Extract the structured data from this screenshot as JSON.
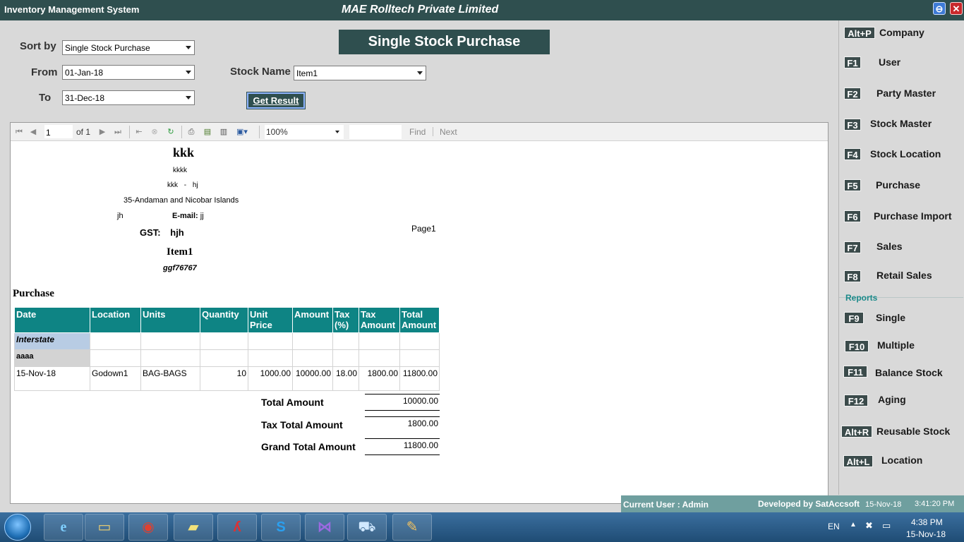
{
  "window": {
    "app_title": "Inventory Management System",
    "company_title": "MAE Rolltech Private Limited",
    "minimize_glyph": "⊖",
    "close_glyph": "✕"
  },
  "filters": {
    "sort_by_label": "Sort by",
    "sort_by_value": "Single Stock Purchase",
    "from_label": "From",
    "from_value": "01-Jan-18",
    "to_label": "To",
    "to_value": "31-Dec-18",
    "stock_name_label": "Stock Name",
    "stock_name_value": "Item1",
    "get_result_label": "Get Result"
  },
  "page_heading": "Single Stock Purchase",
  "viewer_toolbar": {
    "page_value": "1",
    "of_label": "of  1",
    "zoom": "100%",
    "find_label": "Find",
    "next_label": "Next",
    "icons": [
      "first-page-icon",
      "prev-page-icon",
      "next-page-icon",
      "last-page-icon",
      "back-icon",
      "stop-icon",
      "refresh-icon",
      "print-icon",
      "print-layout-icon",
      "page-setup-icon",
      "export-icon"
    ]
  },
  "report": {
    "company_name": "kkk",
    "address1": "kkkk",
    "address2_a": "kkk",
    "address2_sep": "-",
    "address2_b": "hj",
    "state": "35-Andaman and Nicobar Islands",
    "phone": "jh",
    "email_label": "E-mail:",
    "email_value": "jj",
    "gst_label": "GST:",
    "gst_value": "hjh",
    "page_label": "Page1",
    "item_name": "Item1",
    "item_code": "ggf76767",
    "section_title": "Purchase",
    "columns": [
      "Date",
      "Location",
      "Units",
      "Quantity",
      "Unit Price",
      "Amount",
      "Tax (%)",
      "Tax Amount",
      "Total Amount"
    ],
    "group1": "Interstate",
    "group2": "aaaa",
    "rows": [
      {
        "date": "15-Nov-18",
        "location": "Godown1",
        "units": "BAG-BAGS",
        "quantity": "10",
        "unit_price": "1000.00",
        "amount": "10000.00",
        "tax_pct": "18.00",
        "tax_amount": "1800.00",
        "total_amount": "11800.00"
      }
    ],
    "totals": {
      "total_amount_label": "Total Amount",
      "total_amount_value": "10000.00",
      "tax_total_label": "Tax Total Amount",
      "tax_total_value": "1800.00",
      "grand_total_label": "Grand Total Amount",
      "grand_total_value": "11800.00"
    }
  },
  "side_menu": {
    "items": [
      {
        "key": "Alt+P",
        "label": "Company"
      },
      {
        "key": "F1",
        "label": "User"
      },
      {
        "key": "F2",
        "label": "Party Master"
      },
      {
        "key": "F3",
        "label": "Stock Master"
      },
      {
        "key": "F4",
        "label": "Stock Location"
      },
      {
        "key": "F5",
        "label": "Purchase"
      },
      {
        "key": "F6",
        "label": "Purchase Import"
      },
      {
        "key": "F7",
        "label": "Sales"
      },
      {
        "key": "F8",
        "label": "Retail Sales"
      }
    ],
    "reports_heading": "Reports",
    "report_items": [
      {
        "key": "F9",
        "label": "Single"
      },
      {
        "key": "F10",
        "label": "Multiple"
      },
      {
        "key": "F11",
        "label": "Balance Stock"
      },
      {
        "key": "F12",
        "label": "Aging"
      },
      {
        "key": "Alt+R",
        "label": "Reusable Stock"
      },
      {
        "key": "Alt+L",
        "label": "Location"
      }
    ]
  },
  "status_bar": {
    "current_user": "Current User : Admin",
    "developed_by": "Developed by SatAccsoft",
    "date": "15-Nov-18",
    "time": "3:41:20 PM"
  },
  "taskbar": {
    "language": "EN",
    "clock_time": "4:38 PM",
    "clock_date": "15-Nov-18",
    "apps": [
      "internet-explorer-icon",
      "file-explorer-icon",
      "chrome-icon",
      "sticky-notes-icon",
      "pdf-reader-icon",
      "skype-icon",
      "visual-studio-icon",
      "shopping-cart-app-icon",
      "paint-icon"
    ]
  }
}
